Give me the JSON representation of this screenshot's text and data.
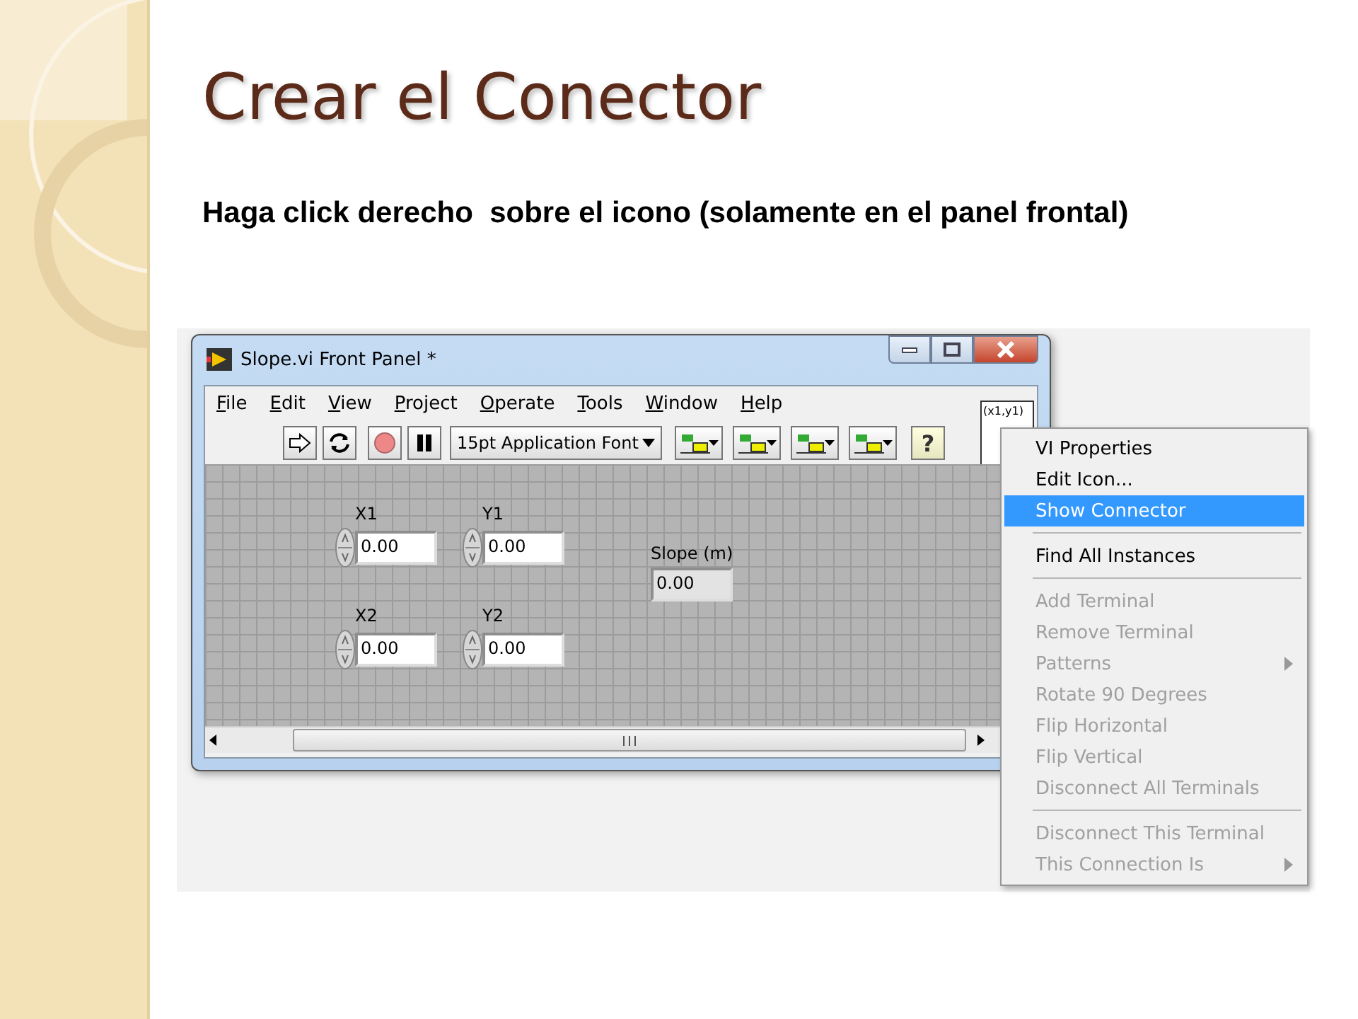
{
  "slide": {
    "title": "Crear el Conector",
    "body": "Haga click derecho  sobre el icono (solamente en el panel frontal)"
  },
  "window": {
    "title": "Slope.vi Front Panel *",
    "menu_bar": [
      "File",
      "Edit",
      "View",
      "Project",
      "Operate",
      "Tools",
      "Window",
      "Help"
    ],
    "toolbar": {
      "font_dropdown": "15pt Application Font",
      "help_button": "?"
    },
    "connector_icon": {
      "label": "(x1,y1)"
    },
    "controls": [
      {
        "kind": "control",
        "label": "X1",
        "value": "0.00"
      },
      {
        "kind": "control",
        "label": "Y1",
        "value": "0.00"
      },
      {
        "kind": "control",
        "label": "X2",
        "value": "0.00"
      },
      {
        "kind": "control",
        "label": "Y2",
        "value": "0.00"
      },
      {
        "kind": "indicator",
        "label": "Slope (m)",
        "value": "0.00"
      }
    ]
  },
  "context_menu": [
    {
      "kind": "item",
      "label": "VI Properties",
      "disabled": false,
      "selected": false,
      "submenu": false
    },
    {
      "kind": "item",
      "label": "Edit Icon...",
      "disabled": false,
      "selected": false,
      "submenu": false
    },
    {
      "kind": "item",
      "label": "Show Connector",
      "disabled": false,
      "selected": true,
      "submenu": false
    },
    {
      "kind": "separator"
    },
    {
      "kind": "item",
      "label": "Find All Instances",
      "disabled": false,
      "selected": false,
      "submenu": false
    },
    {
      "kind": "separator"
    },
    {
      "kind": "item",
      "label": "Add Terminal",
      "disabled": true,
      "selected": false,
      "submenu": false
    },
    {
      "kind": "item",
      "label": "Remove Terminal",
      "disabled": true,
      "selected": false,
      "submenu": false
    },
    {
      "kind": "item",
      "label": "Patterns",
      "disabled": true,
      "selected": false,
      "submenu": true
    },
    {
      "kind": "item",
      "label": "Rotate 90 Degrees",
      "disabled": true,
      "selected": false,
      "submenu": false
    },
    {
      "kind": "item",
      "label": "Flip Horizontal",
      "disabled": true,
      "selected": false,
      "submenu": false
    },
    {
      "kind": "item",
      "label": "Flip Vertical",
      "disabled": true,
      "selected": false,
      "submenu": false
    },
    {
      "kind": "item",
      "label": "Disconnect All Terminals",
      "disabled": true,
      "selected": false,
      "submenu": false
    },
    {
      "kind": "separator"
    },
    {
      "kind": "item",
      "label": "Disconnect This Terminal",
      "disabled": true,
      "selected": false,
      "submenu": false
    },
    {
      "kind": "item",
      "label": "This Connection Is",
      "disabled": true,
      "selected": false,
      "submenu": true
    }
  ]
}
